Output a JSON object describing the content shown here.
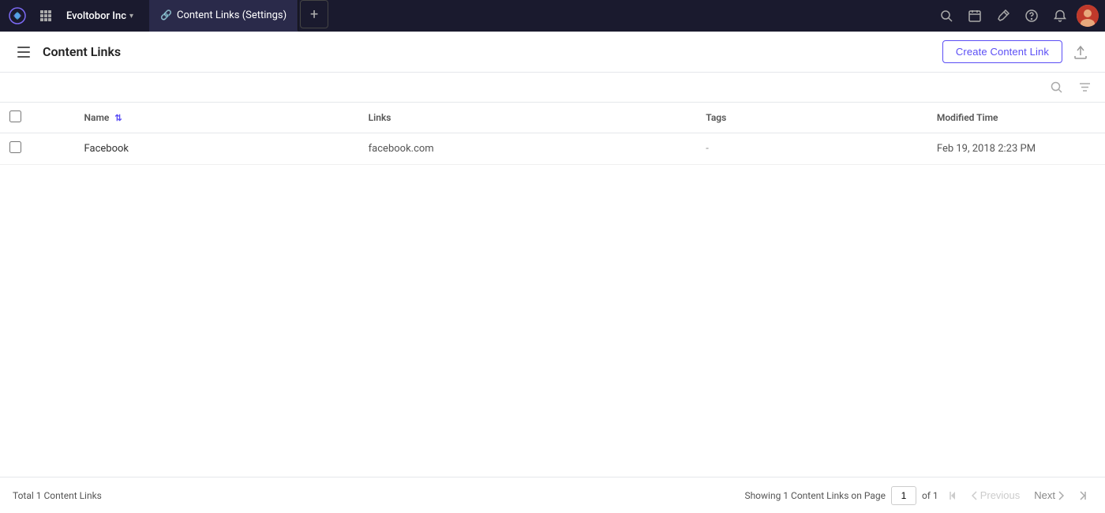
{
  "app": {
    "logo_alt": "App Logo",
    "org_name": "Evoltobor Inc",
    "tab_label": "Content Links (Settings)",
    "tab_icon": "link-icon",
    "add_tab_label": "+"
  },
  "nav_icons": {
    "search": "🔍",
    "calendar": "📅",
    "edit": "✏️",
    "help": "❓",
    "bell": "🔔"
  },
  "sub_header": {
    "title": "Content Links",
    "create_button_label": "Create Content Link",
    "export_icon": "↑"
  },
  "toolbar": {
    "search_icon": "🔍",
    "filter_icon": "▽"
  },
  "table": {
    "columns": [
      {
        "key": "checkbox",
        "label": ""
      },
      {
        "key": "dots",
        "label": ""
      },
      {
        "key": "name",
        "label": "Name",
        "sortable": true
      },
      {
        "key": "links",
        "label": "Links"
      },
      {
        "key": "tags",
        "label": "Tags"
      },
      {
        "key": "modified_time",
        "label": "Modified Time"
      }
    ],
    "rows": [
      {
        "id": 1,
        "name": "Facebook",
        "links": "facebook.com",
        "tags": "-",
        "modified_time": "Feb 19, 2018 2:23 PM"
      }
    ]
  },
  "footer": {
    "total_label": "Total 1 Content Links",
    "showing_prefix": "Showing 1 Content Links on Page",
    "page_current": "1",
    "page_of": "of 1",
    "btn_first": "⟨⟨",
    "btn_prev": "Previous",
    "btn_prev_icon": "‹",
    "btn_next": "Next",
    "btn_next_icon": "›",
    "btn_last": "⟩⟩"
  }
}
